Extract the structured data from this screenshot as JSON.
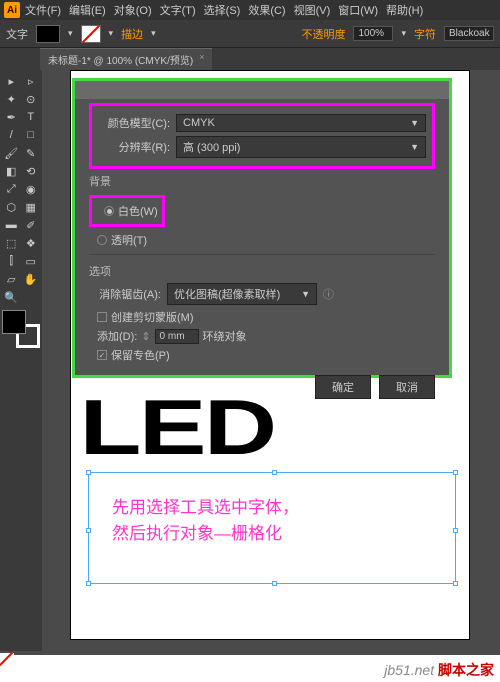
{
  "menu": {
    "file": "文件(F)",
    "edit": "编辑(E)",
    "object": "对象(O)",
    "type": "文字(T)",
    "select": "选择(S)",
    "effect": "效果(C)",
    "view": "视图(V)",
    "window": "窗口(W)",
    "help": "帮助(H)"
  },
  "optbar": {
    "label": "文字",
    "stroke_lbl": "描边",
    "opacity_lbl": "不透明度",
    "opacity_val": "100%",
    "style_lbl": "字符",
    "font": "Blackoak"
  },
  "tab": {
    "title": "未标题-1* @ 100% (CMYK/预览)",
    "close": "×"
  },
  "dialog": {
    "color_model_lbl": "颜色模型(C):",
    "color_model_val": "CMYK",
    "resolution_lbl": "分辨率(R):",
    "resolution_val": "高 (300 ppi)",
    "bg_title": "背景",
    "bg_white": "白色(W)",
    "bg_transparent": "透明(T)",
    "options_title": "选项",
    "antialias_lbl": "消除锯齿(A):",
    "antialias_val": "优化图稿(超像素取样)",
    "clipmask": "创建剪切蒙版(M)",
    "add_lbl": "添加(D):",
    "add_val": "0 mm",
    "add_suffix": "环绕对象",
    "preserve_spot": "保留专色(P)",
    "ok": "确定",
    "cancel": "取消"
  },
  "canvas": {
    "led": "LED"
  },
  "annotation": {
    "line1": "先用选择工具选中字体，",
    "line2": "然后执行对象—栅格化"
  },
  "watermark": {
    "text": "脚本之家",
    "url": "jb51.net"
  },
  "icons": {
    "sel": "▸",
    "dsel": "▹",
    "wand": "✦",
    "lasso": "⊙",
    "pen": "✒",
    "type": "T",
    "line": "/",
    "rect": "□",
    "brush": "🖌",
    "pencil": "✎",
    "erase": "◧",
    "rot": "⟲",
    "scale": "⤢",
    "warp": "◉",
    "shape": "⬡",
    "mesh": "▦",
    "grad": "▬",
    "eyedrop": "✐",
    "blend": "⬚",
    "sym": "❖",
    "graph": "⫿",
    "art": "▭",
    "slice": "▱",
    "hand": "✋",
    "zoom": "🔍"
  }
}
